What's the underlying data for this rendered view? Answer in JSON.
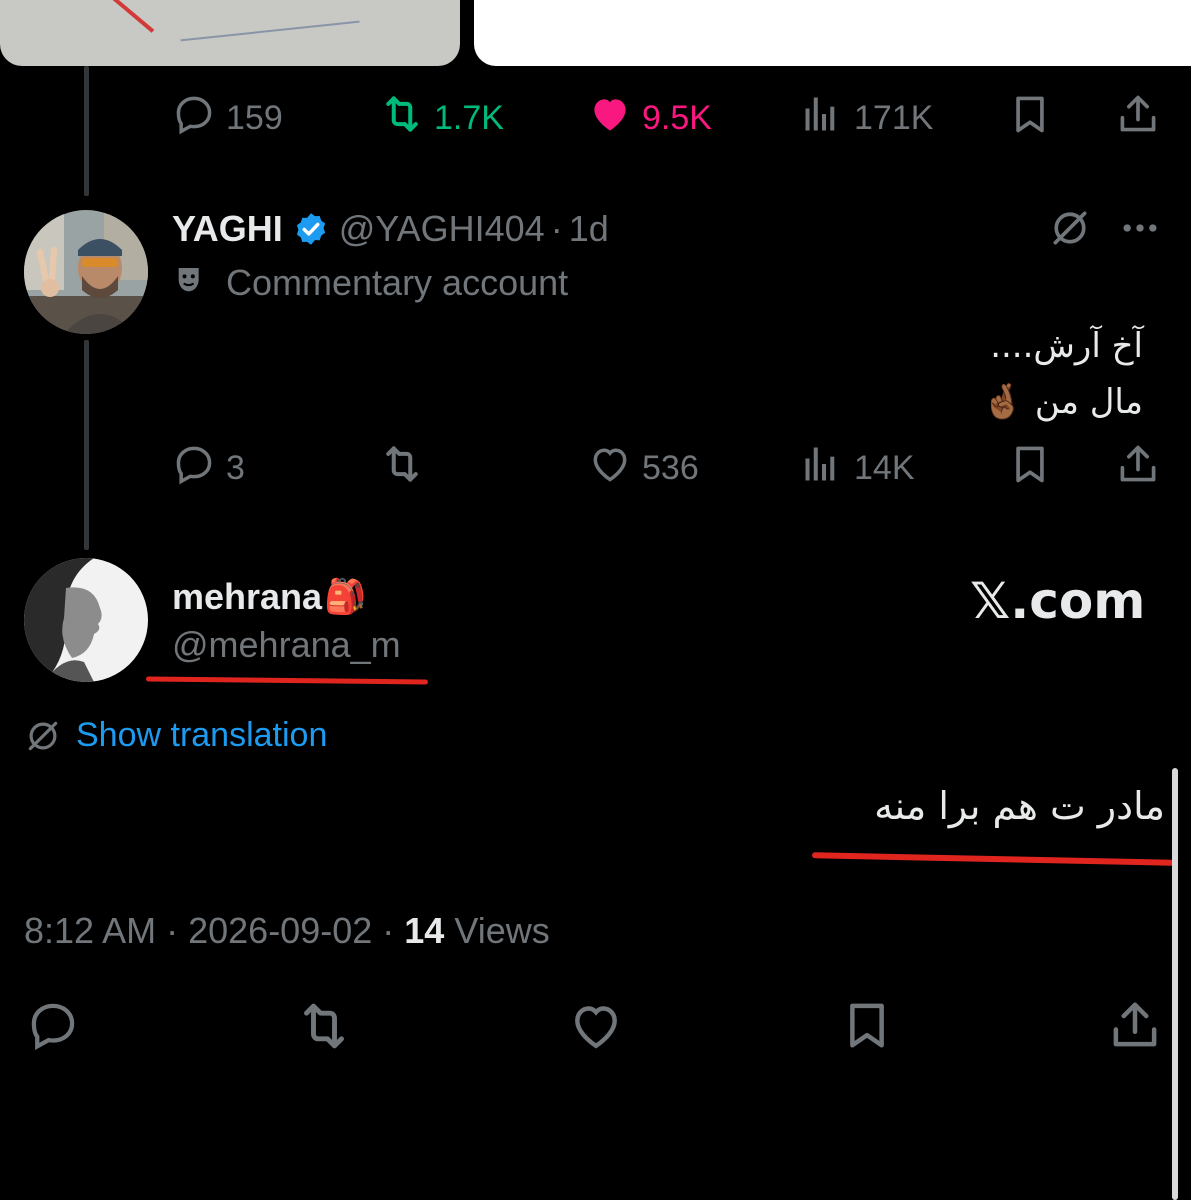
{
  "colors": {
    "background": "#000000",
    "text": "#e7e9ea",
    "muted": "#71767b",
    "retweet_active": "#00ba7c",
    "like_active": "#f91880",
    "link": "#1d9bf0",
    "verified": "#1d9bf0",
    "annotation_red": "#e0251f"
  },
  "tweet1": {
    "stats": {
      "replies": "159",
      "retweets": "1.7K",
      "likes": "9.5K",
      "views": "171K"
    }
  },
  "tweet2": {
    "author_name": "YAGHI",
    "author_handle": "@YAGHI404",
    "separator": "·",
    "time": "1d",
    "label": "Commentary account",
    "text_line1": "آخ آرش....",
    "text_line2": "مال من 🤞🏾",
    "stats": {
      "replies": "3",
      "likes": "536",
      "views": "14K"
    }
  },
  "tweet3": {
    "author_name": "mehrana",
    "author_emoji": "🎒",
    "author_handle": "@mehrana_m",
    "watermark": "𝕏.com",
    "show_translation": "Show translation",
    "text": "مادر ت هم برا منه",
    "time": "8:12 AM",
    "date": "2026-09-02",
    "views_count": "14",
    "views_label": "Views"
  }
}
